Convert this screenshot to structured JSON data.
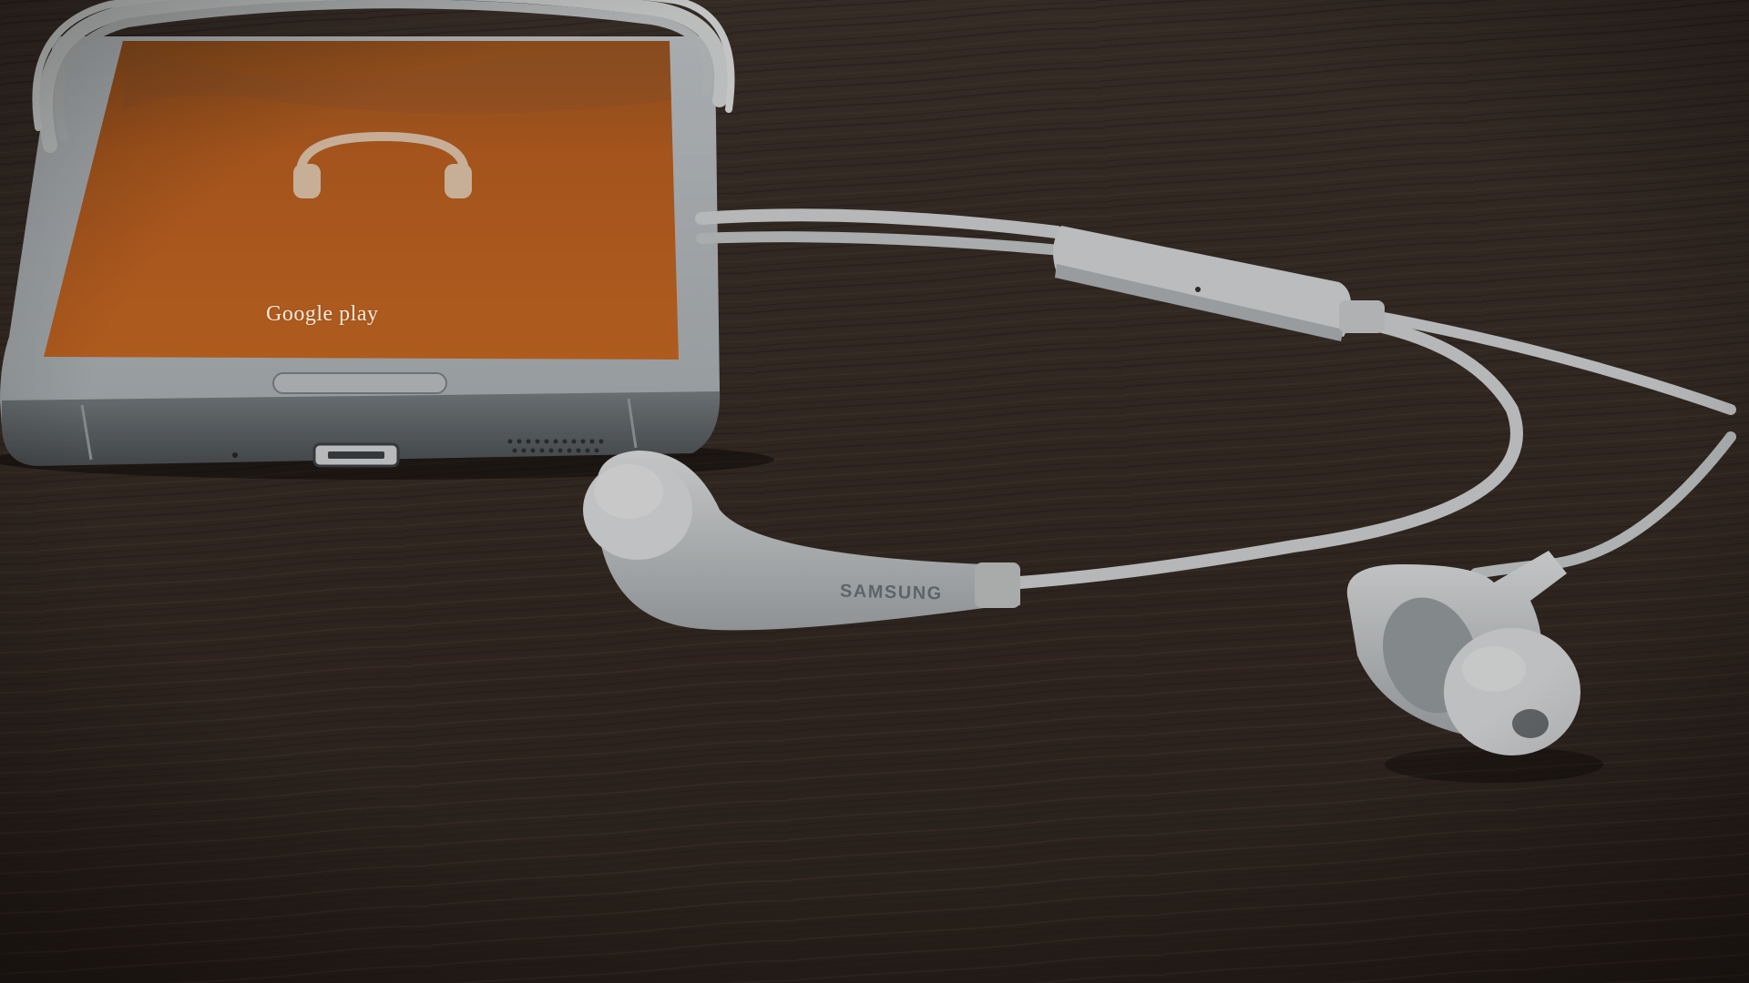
{
  "phone": {
    "screen_label": "Google play",
    "screen_icon": "headphones-icon",
    "screen_color": "#c8651f"
  },
  "earphones": {
    "brand_label": "SAMSUNG",
    "color": "#d7dadc"
  },
  "table": {
    "color": "#3a2e27"
  }
}
